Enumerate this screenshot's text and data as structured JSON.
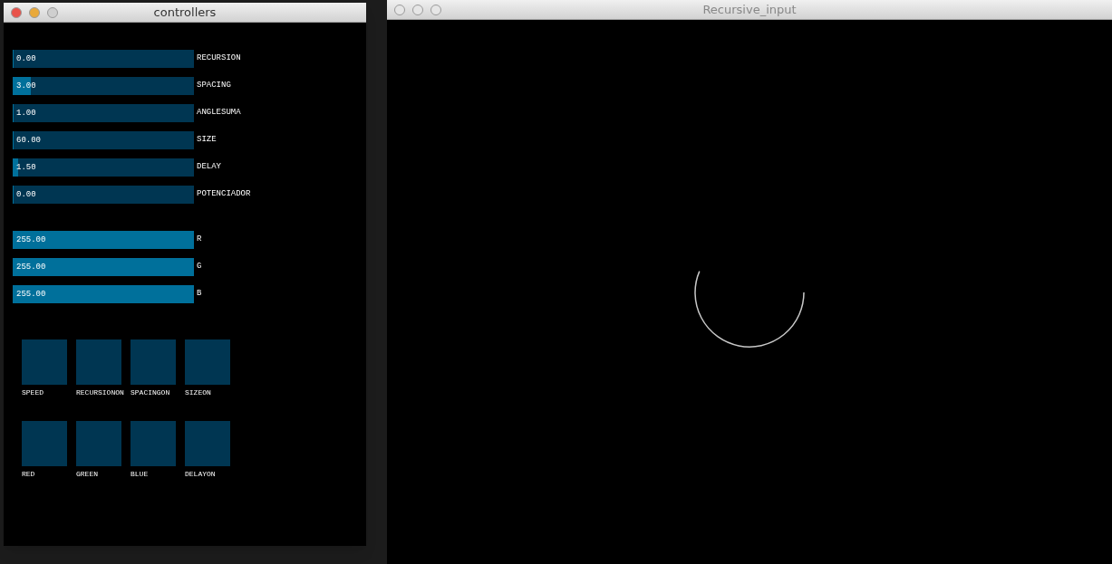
{
  "controllers_window": {
    "title": "controllers",
    "active": true,
    "sliders": [
      {
        "value": "0.00",
        "label": "RECURSION",
        "level": 0
      },
      {
        "value": "3.00",
        "label": "SPACING",
        "level": 0.1
      },
      {
        "value": "1.00",
        "label": "ANGLESUMA",
        "level": 0
      },
      {
        "value": "60.00",
        "label": "SIZE",
        "level": 0
      },
      {
        "value": "1.50",
        "label": "DELAY",
        "level": 0.03
      },
      {
        "value": "0.00",
        "label": "POTENCIADOR",
        "level": 0
      }
    ],
    "color_sliders": [
      {
        "value": "255.00",
        "label": "R",
        "level": 1
      },
      {
        "value": "255.00",
        "label": "G",
        "level": 1
      },
      {
        "value": "255.00",
        "label": "B",
        "level": 1
      }
    ],
    "toggles": [
      {
        "label": "SPEED",
        "on": false
      },
      {
        "label": "RECURSIONON",
        "on": false
      },
      {
        "label": "SPACINGON",
        "on": false
      },
      {
        "label": "SIZEON",
        "on": false
      },
      {
        "label": "RED",
        "on": false
      },
      {
        "label": "GREEN",
        "on": false
      },
      {
        "label": "BLUE",
        "on": false
      },
      {
        "label": "DELAYON",
        "on": false
      }
    ]
  },
  "canvas_window": {
    "title": "Recursive_input",
    "active": false
  }
}
